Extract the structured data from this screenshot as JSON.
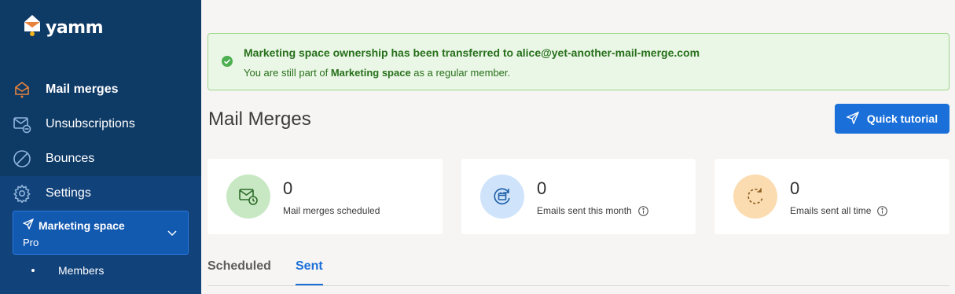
{
  "brand": {
    "name": "yamm"
  },
  "sidebar": {
    "items": [
      {
        "label": "Mail merges",
        "icon": "mail-merge-icon",
        "active": true
      },
      {
        "label": "Unsubscriptions",
        "icon": "unsubscribe-mail-icon"
      },
      {
        "label": "Bounces",
        "icon": "bounce-icon"
      },
      {
        "label": "Settings",
        "icon": "gear-icon"
      }
    ],
    "space": {
      "name": "Marketing space",
      "plan": "Pro"
    },
    "subitems": [
      {
        "label": "Members"
      }
    ]
  },
  "alert": {
    "title": "Marketing space ownership has been transferred to alice@yet-another-mail-merge.com",
    "text_prefix": "You are still part of ",
    "text_bold": "Marketing space",
    "text_suffix": " as a regular member."
  },
  "main": {
    "title": "Mail Merges",
    "tutorial_button": "Quick tutorial",
    "stats": [
      {
        "value": "0",
        "label": "Mail merges scheduled",
        "icon": "scheduled-mail-icon",
        "color": "#c8e8c4"
      },
      {
        "value": "0",
        "label": "Emails sent this month",
        "icon": "calendar-refresh-icon",
        "color": "#cfe4fb",
        "info": true
      },
      {
        "value": "0",
        "label": "Emails sent all time",
        "icon": "refresh-icon",
        "color": "#fbdcb0",
        "info": true
      }
    ],
    "tabs": [
      {
        "label": "Scheduled"
      },
      {
        "label": "Sent",
        "active": true
      }
    ]
  },
  "colors": {
    "sidebar": "#0e3a66",
    "accent": "#1a6fd9",
    "success": "#27701c"
  }
}
